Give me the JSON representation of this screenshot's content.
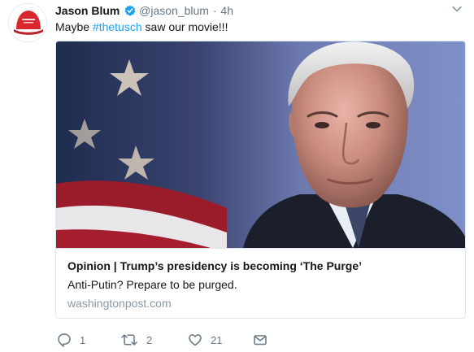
{
  "tweet": {
    "display_name": "Jason Blum",
    "handle": "@jason_blum",
    "separator": "·",
    "time": "4h",
    "text_before": "Maybe ",
    "hashtag": "#thetusch",
    "text_after": " saw our movie!!!"
  },
  "card": {
    "title": "Opinion | Trump’s presidency is becoming ‘The Purge’",
    "description": "Anti-Putin? Prepare to be purged.",
    "domain": "washingtonpost.com"
  },
  "actions": {
    "reply_count": "1",
    "retweet_count": "2",
    "like_count": "21"
  },
  "colors": {
    "link": "#1da1f2",
    "muted": "#657786",
    "verified": "#1da1f2",
    "avatar_hat": "#d9272e"
  },
  "icons": [
    "avatar-red-cap",
    "verified-badge-icon",
    "chevron-down-icon",
    "reply-icon",
    "retweet-icon",
    "like-heart-icon",
    "direct-message-icon"
  ]
}
